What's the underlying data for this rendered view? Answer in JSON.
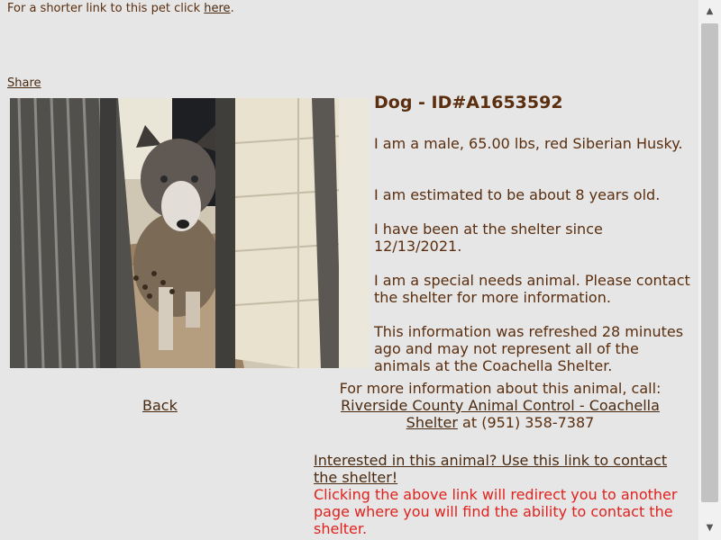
{
  "header": {
    "shorter_link_text": "For a shorter link to this pet click",
    "shorter_link_label": "here",
    "shorter_link_suffix": "."
  },
  "share_label": "Share",
  "photo": {
    "alt": "Siberian Husky dog in shelter kennel"
  },
  "animal": {
    "title": "Dog - ID#A1653592",
    "description": "I am a male, 65.00 lbs, red Siberian Husky.",
    "age": "I am estimated to be about 8 years old.",
    "shelter_since": "I have been at the shelter since 12/13/2021.",
    "special_needs": "I am a special needs animal. Please contact the shelter for more information.",
    "refreshed": "This information was refreshed 28 minutes ago and may not represent all of the animals at the Coachella Shelter."
  },
  "back_label": "Back",
  "contact": {
    "intro": "For more information about this animal, call:",
    "shelter_name": "Riverside County Animal Control - Coachella Shelter",
    "phone": "at (951) 358-7387",
    "interested_link": "Interested in this animal? Use this link to contact the shelter!",
    "redirect_warning": "Clicking the above link will redirect you to another page where you will find the ability to contact the shelter."
  },
  "colors": {
    "text": "#5a2e0e",
    "background": "#e6e6e6",
    "warning": "#e0221e"
  }
}
